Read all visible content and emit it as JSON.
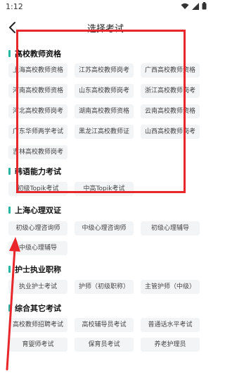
{
  "status": {
    "time": "1:12"
  },
  "header": {
    "title": "选择考试"
  },
  "sections": [
    {
      "title": "高校教师资格",
      "chips": [
        "上海高校教师资格",
        "江苏高校教师岗考",
        "广西高校教师资格",
        "河南高校教师资格",
        "山东高校教师岗考",
        "浙江高校教师岗考",
        "河北高校教师岗考",
        "湖南高校教师资格",
        "云南高校教师资格",
        "广东华师两学考试",
        "黑龙江高校教师证",
        "山西高校教师岗考",
        "吉林高校教师岗考"
      ]
    },
    {
      "title": "韩语能力考试",
      "chips": [
        "初级Topik考试",
        "中高Topik考试"
      ]
    },
    {
      "title": "上海心理双证",
      "chips": [
        "初级心理咨询师",
        "中级心理咨询师",
        "初级心理辅导",
        "中级心理辅导"
      ]
    },
    {
      "title": "护士执业职称",
      "chips": [
        "执业护士考试",
        "护师（初级职称）",
        "主管护师（中级）"
      ]
    },
    {
      "title": "综合其它考试",
      "chips": [
        "高校教师招聘考试",
        "高校辅导员考试",
        "普通话水平考试",
        "育婴师考试",
        "保育员考试",
        "养老护理员"
      ]
    }
  ],
  "colors": {
    "accent": "#27b5a4",
    "chip_bg": "#f3f4f6",
    "annotation": "#e8262b"
  }
}
